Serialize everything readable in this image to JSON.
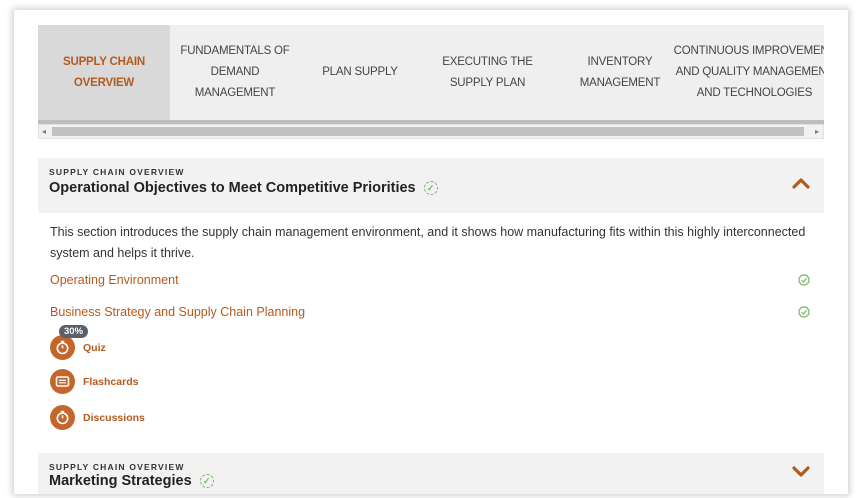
{
  "tabs": [
    {
      "label": "SUPPLY CHAIN OVERVIEW",
      "active": true
    },
    {
      "label": "FUNDAMENTALS OF DEMAND MANAGEMENT",
      "active": false
    },
    {
      "label": "PLAN SUPPLY",
      "active": false
    },
    {
      "label": "EXECUTING THE SUPPLY PLAN",
      "active": false
    },
    {
      "label": "INVENTORY MANAGEMENT",
      "active": false
    },
    {
      "label": "CONTINUOUS IMPROVEMENT AND QUALITY MANAGEMENT AND TECHNOLOGIES",
      "active": false
    }
  ],
  "tab_lines": {
    "t1": [
      "FUNDAMENTALS OF DEMAND",
      "MANAGEMENT"
    ],
    "t5": [
      "CONTINUOUS IMPROVEMENT",
      "AND QUALITY MANAGEMENT",
      "AND TECHNOLOGIES"
    ]
  },
  "section1": {
    "eyebrow": "SUPPLY CHAIN OVERVIEW",
    "title": "Operational Objectives to Meet Competitive Priorities",
    "expanded": true,
    "description": "This section introduces the supply chain management environment, and it shows how manufacturing fits within this highly interconnected system and helps it thrive.",
    "lessons": [
      {
        "label": "Operating Environment",
        "completed": true
      },
      {
        "label": "Business Strategy and Supply Chain Planning",
        "completed": true
      }
    ],
    "activities": [
      {
        "label": "Quiz",
        "icon": "timer-icon",
        "badge": "30%"
      },
      {
        "label": "Flashcards",
        "icon": "flashcards-icon"
      },
      {
        "label": "Discussions",
        "icon": "timer-icon"
      }
    ]
  },
  "section2": {
    "eyebrow": "SUPPLY CHAIN OVERVIEW",
    "title": "Marketing Strategies",
    "expanded": false
  },
  "colors": {
    "accent": "#b35a1f",
    "icon_bg": "#c2662b",
    "check": "#79b86a",
    "badge": "#5a6069"
  }
}
